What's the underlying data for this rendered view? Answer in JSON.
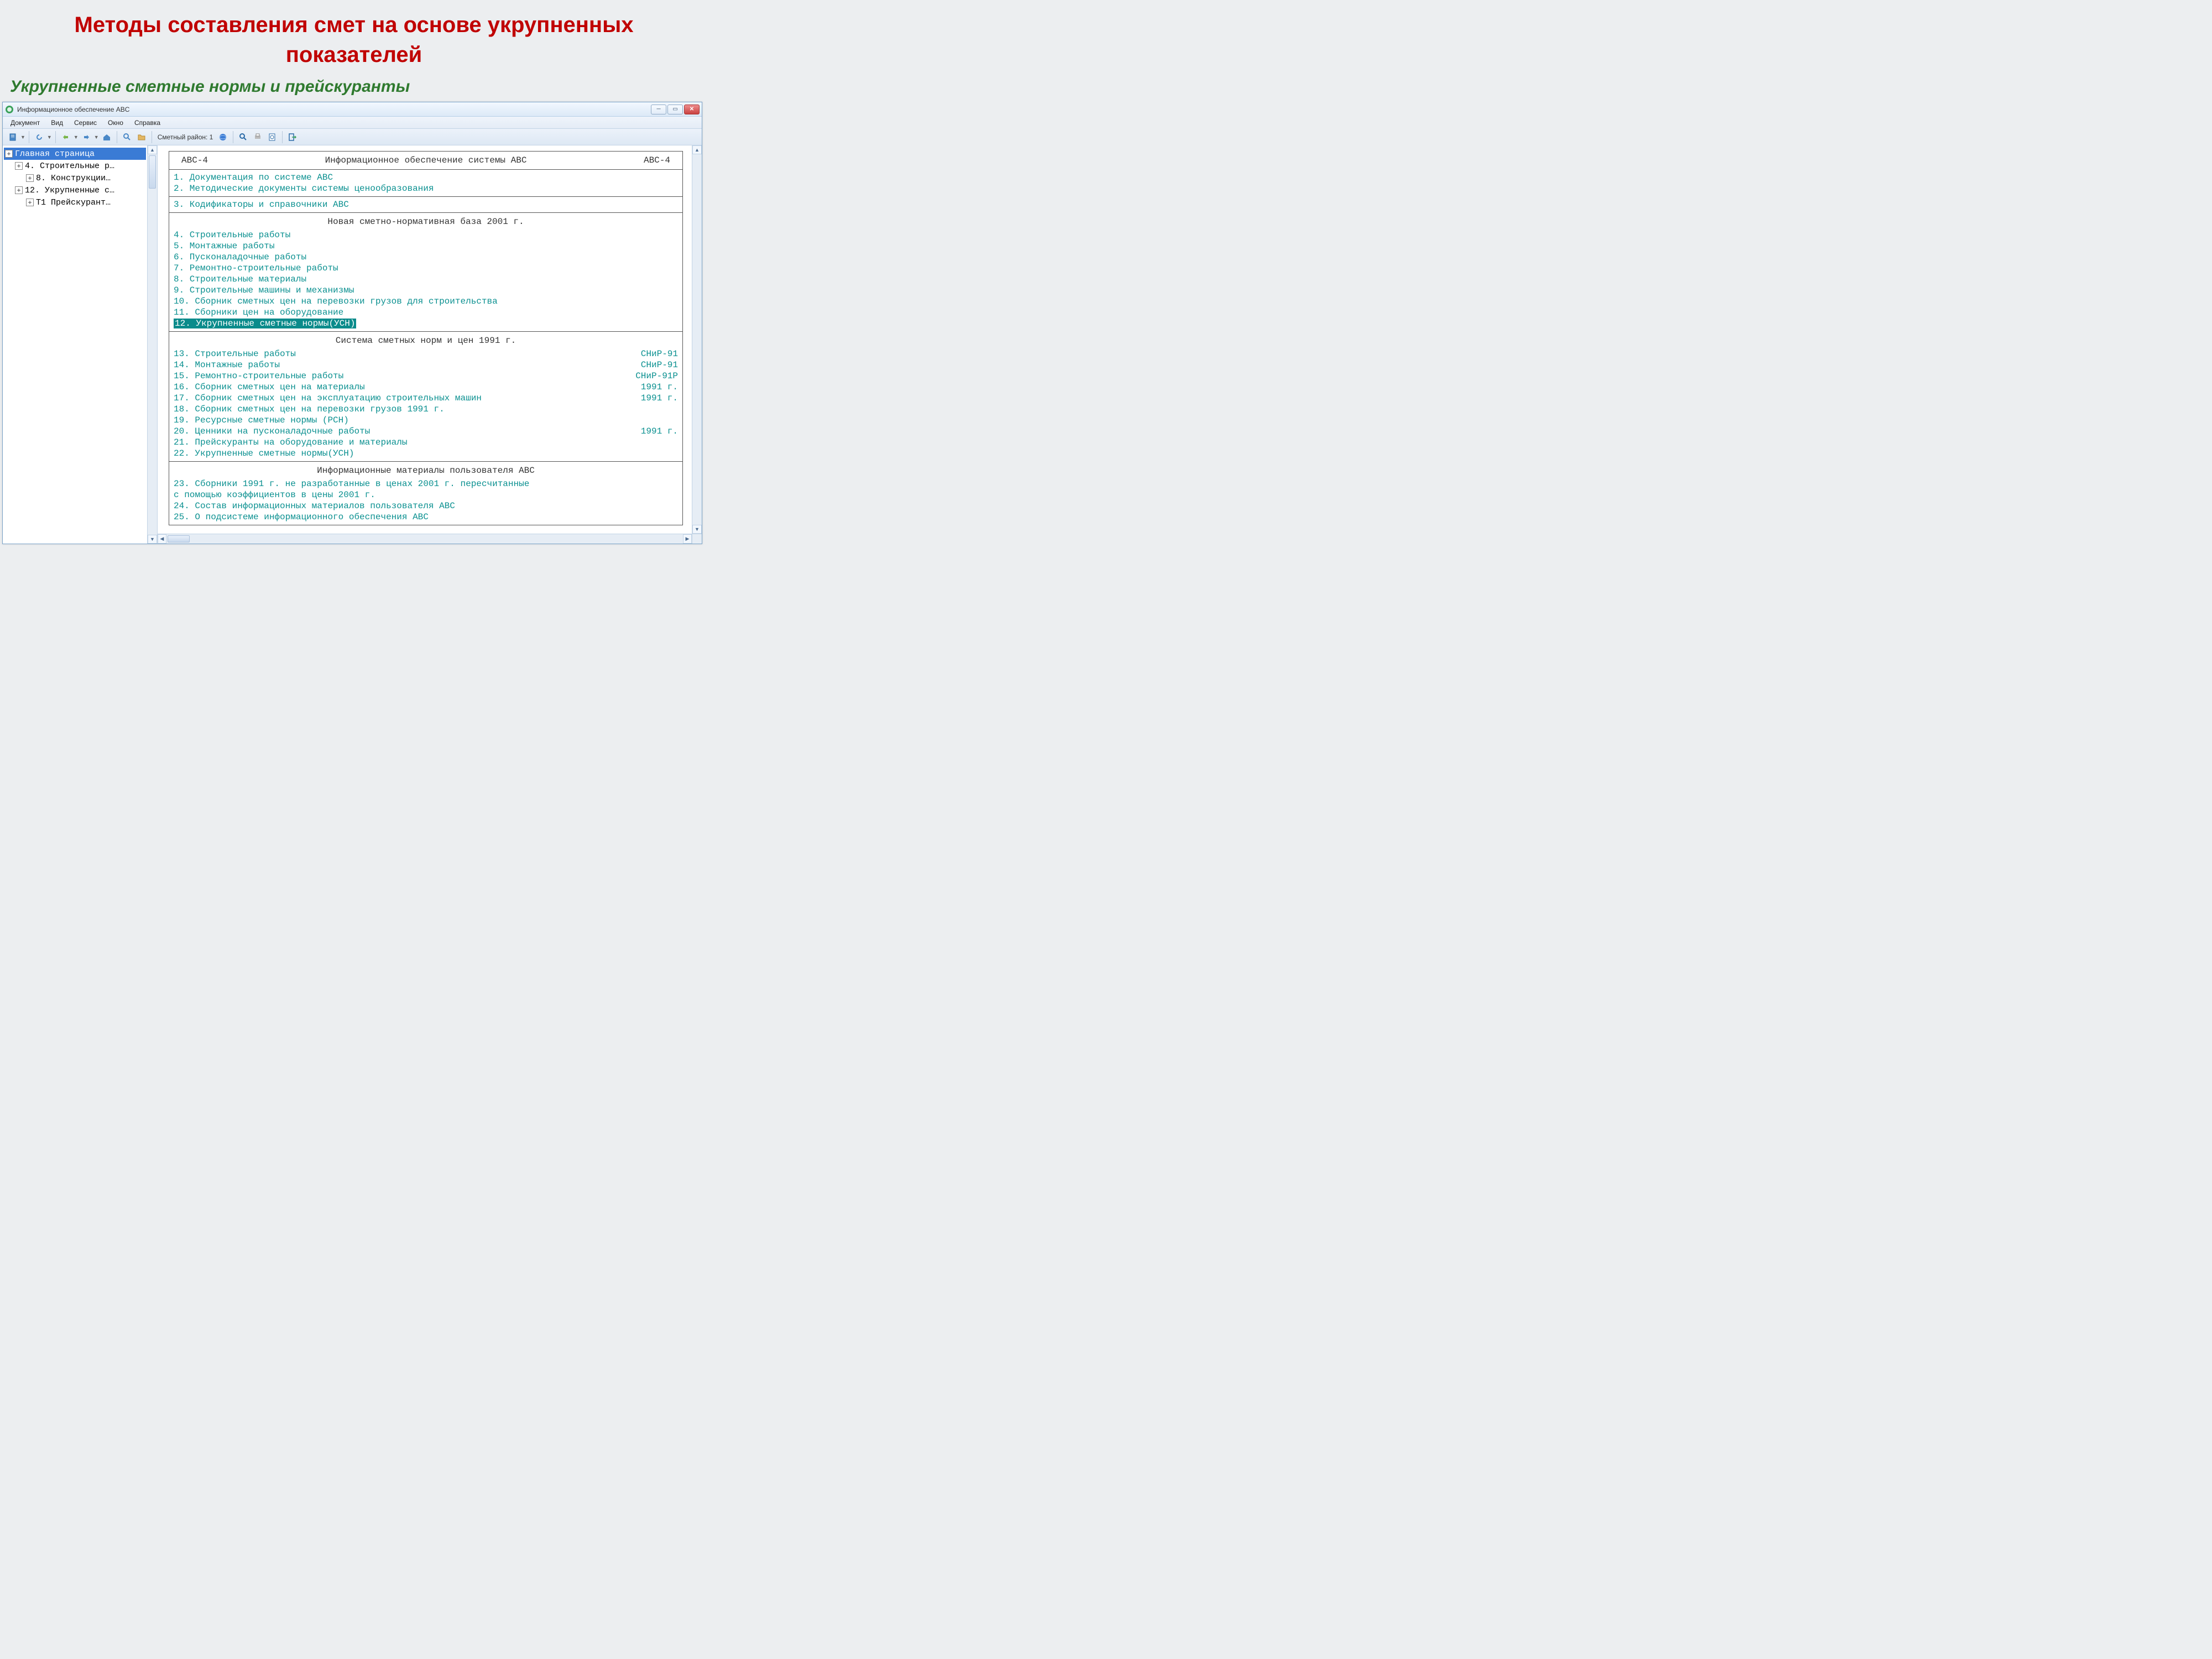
{
  "slide": {
    "title": "Методы составления смет на основе укрупненных показателей",
    "subtitle": "Укрупненные сметные нормы и прейскуранты"
  },
  "window": {
    "title": "Информационное обеспечение ABC"
  },
  "menu": [
    "Документ",
    "Вид",
    "Сервис",
    "Окно",
    "Справка"
  ],
  "toolbar": {
    "district_label": "Сметный район: 1"
  },
  "tree": [
    {
      "level": 0,
      "label": "Главная страница",
      "selected": true,
      "expandable": true
    },
    {
      "level": 1,
      "label": "4. Строительные р…",
      "expandable": true
    },
    {
      "level": 2,
      "label": "8. Конструкции…",
      "expandable": true
    },
    {
      "level": 1,
      "label": "12. Укрупненные с…",
      "expandable": true
    },
    {
      "level": 2,
      "label": "Т1 Прейскурант…",
      "expandable": true
    }
  ],
  "doc": {
    "header": {
      "left": "ABC-4",
      "center": "Информационное обеспечение системы ABC",
      "right": "ABC-4"
    },
    "section1": [
      "1. Документация по системе ABC",
      "2. Методические документы системы ценообразования"
    ],
    "section2": [
      "3. Кодификаторы и справочники ABC"
    ],
    "section3_title": "Новая сметно-нормативная база 2001 г.",
    "section3": [
      "4. Строительные работы",
      "5. Монтажные работы",
      "6. Пусконаладочные работы",
      "7. Ремонтно-строительные работы",
      "8. Строительные материалы",
      "9. Строительные машины и механизмы",
      "10. Сборник сметных цен на перевозки грузов для строительства",
      "11. Сборники цен на оборудование"
    ],
    "section3_highlight": "12. Укрупненные сметные нормы(УСН)",
    "section4_title": "Система сметных норм и цен 1991 г.",
    "section4": [
      {
        "text": "13. Строительные работы",
        "suffix": "СНиР-91"
      },
      {
        "text": "14. Монтажные работы",
        "suffix": "СНиР-91"
      },
      {
        "text": "15. Ремонтно-строительные работы",
        "suffix": "СНиР-91Р"
      },
      {
        "text": "16. Сборник сметных цен на материалы",
        "suffix": "1991 г."
      },
      {
        "text": "17. Сборник сметных цен на эксплуатацию строительных машин",
        "suffix": "1991 г."
      },
      {
        "text": "18. Сборник сметных цен на перевозки грузов 1991 г.",
        "suffix": ""
      },
      {
        "text": "19. Ресурсные сметные нормы (РСН)",
        "suffix": ""
      },
      {
        "text": "20. Ценники на пусконаладочные работы",
        "suffix": "1991 г."
      },
      {
        "text": "21. Прейскуранты на оборудование и материалы",
        "suffix": ""
      },
      {
        "text": "22. Укрупненные сметные нормы(УСН)",
        "suffix": ""
      }
    ],
    "section5_title": "Информационные материалы пользователя ABC",
    "section5": [
      "23.  Сборники 1991 г. не разработанные в ценах 2001 г. пересчитанные",
      "     с помощью коэффициентов в цены 2001 г.",
      "24.  Состав информационных материалов пользователя ABC",
      "25.  О подсистеме информационного обеспечения ABC"
    ],
    "rule": "=-=-=-=-=-=-=-=-=-=-=-=-=-=-=-=-=-=-=-=-=-=-=-=-=-=-=-=-="
  }
}
